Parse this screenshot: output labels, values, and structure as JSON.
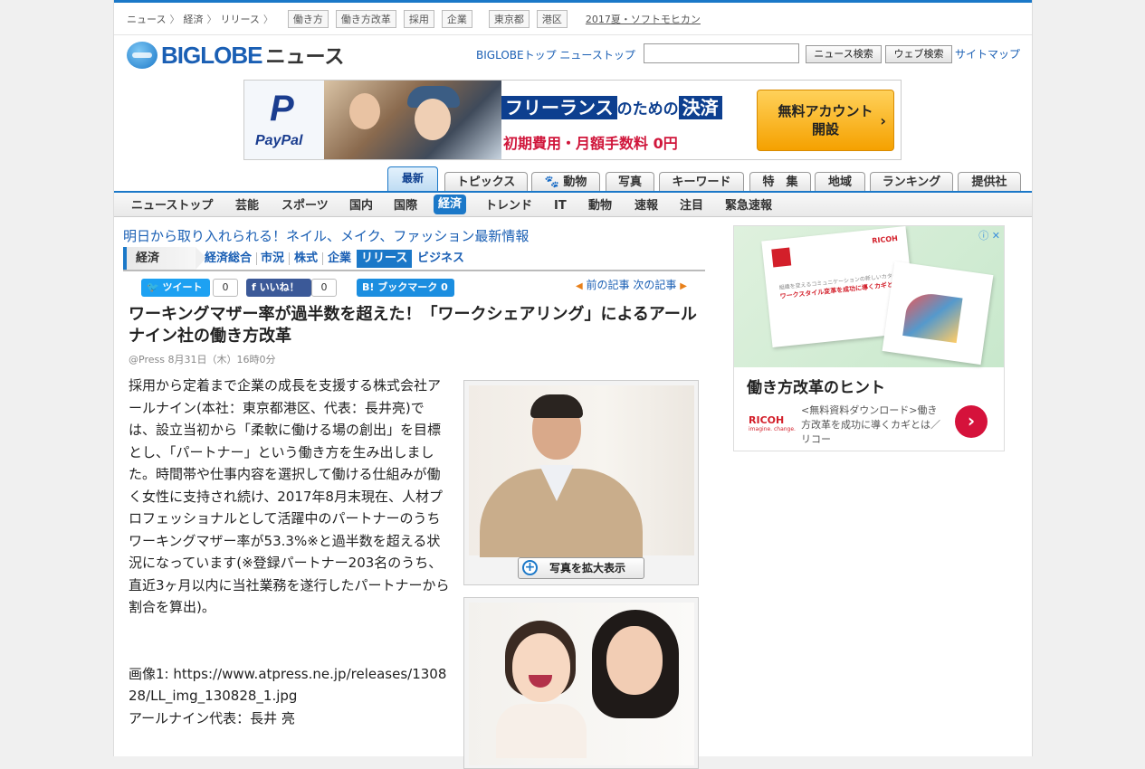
{
  "breadcrumbs": [
    "ニュース",
    "経済",
    "リリース"
  ],
  "breadcrumb_sep": "〉",
  "tags": [
    "働き方",
    "働き方改革",
    "採用",
    "企業",
    "東京都",
    "港区"
  ],
  "special_link": "2017夏・ソフトモヒカン",
  "logo": {
    "brand": "BIGLOBE",
    "suffix": "ニュース"
  },
  "header_links": [
    "BIGLOBEトップ",
    "ニューストップ"
  ],
  "search": {
    "value": "",
    "news_button": "ニュース検索",
    "web_button": "ウェブ検索"
  },
  "sitemap": "サイトマップ",
  "banner_ad": {
    "brand": "PayPal",
    "headline_box1": "フリーランス",
    "headline_mid": "のための",
    "headline_box2": "決済",
    "subline": "初期費用・月額手数料 0円",
    "cta_line1": "無料アカウント",
    "cta_line2": "開設",
    "cta_arrow": "›"
  },
  "tabs": [
    "最新",
    "トピックス",
    "動物",
    "写真",
    "キーワード",
    "特　集",
    "地域",
    "ランキング",
    "提供社"
  ],
  "active_tab": "最新",
  "nav": [
    "ニューストップ",
    "芸能",
    "スポーツ",
    "国内",
    "国際",
    "経済",
    "トレンド",
    "IT",
    "動物",
    "速報",
    "注目",
    "緊急速報"
  ],
  "active_nav": "経済",
  "promo_link": "明日から取り入れられる！ネイル、メイク、ファッション最新情報",
  "section": {
    "name": "経済",
    "items": [
      "経済総合",
      "市況",
      "株式",
      "企業",
      "リリース",
      "ビジネス"
    ],
    "active": "リリース"
  },
  "social": {
    "tweet": "ツイート",
    "tweet_count": "0",
    "like": "いいね！",
    "like_count": "0",
    "hatena": "ブックマーク",
    "hatena_count": "0"
  },
  "prev_next": {
    "prev": "前の記事",
    "next": "次の記事"
  },
  "article": {
    "title": "ワーキングマザー率が過半数を超えた！「ワークシェアリング」によるアールナイン社の働き方改革",
    "byline": "@Press  8月31日（木）16時0分",
    "paragraph1": "採用から定着まで企業の成長を支援する株式会社アールナイン(本社：東京都港区、代表：長井亮)では、設立当初から「柔軟に働ける場の創出」を目標とし、「パートナー」という働き方を生み出しました。時間帯や仕事内容を選択して働ける仕組みが働く女性に支持され続け、2017年8月末現在、人材プロフェッショナルとして活躍中のパートナーのうちワーキングマザー率が53.3%※と過半数を超える状況になっています(※登録パートナー203名のうち、直近3ヶ月以内に当社業務を遂行したパートナーから割合を算出)。",
    "image_caption_label": "画像1: https://www.atpress.ne.jp/releases/130828/LL_img_130828_1.jpg",
    "image_caption_person": "アールナイン代表：長井 亮",
    "zoom_button": "写真を拡大表示"
  },
  "side_ad": {
    "title": "働き方改革のヒント",
    "brand": "RICOH",
    "tagline": "imagine. change.",
    "text": "<無料資料ダウンロード>働き方改革を成功に導くカギとは／リコー",
    "doc_line1": "組織を変えるコミュニケーションの新しいカタチ",
    "doc_line2": "ワークスタイル変革を成功に導くカギとは",
    "adchoices": "ⓘ ✕"
  },
  "colors": {
    "accent": "#1b78c8",
    "link": "#1a5fb4",
    "paypal": "#1a3d8f",
    "ricoh": "#d31f2a"
  }
}
